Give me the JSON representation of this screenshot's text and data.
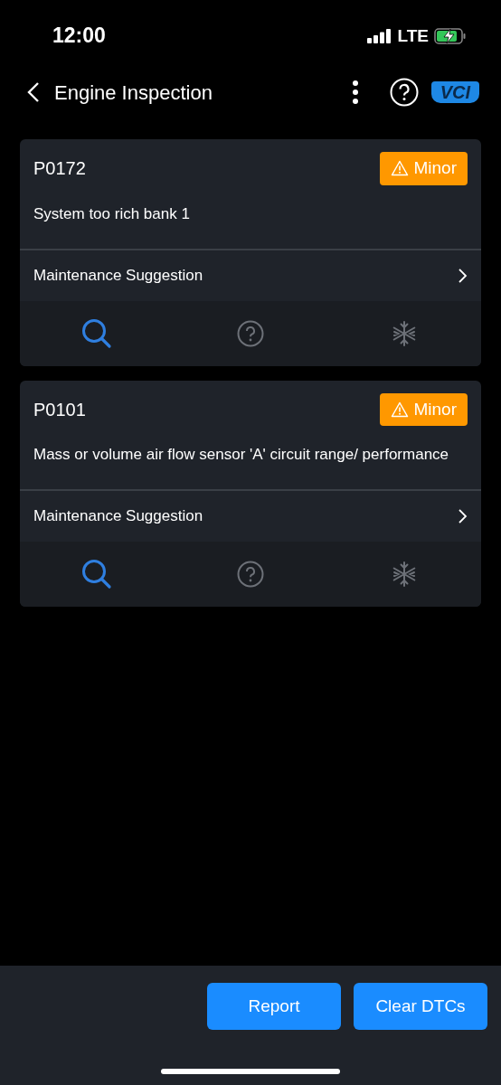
{
  "status_bar": {
    "time": "12:00",
    "network": "LTE"
  },
  "header": {
    "title": "Engine Inspection",
    "vci_label": "VCI"
  },
  "codes": [
    {
      "code": "P0172",
      "severity": "Minor",
      "description": "System too rich bank 1",
      "suggestion": "Maintenance Suggestion"
    },
    {
      "code": "P0101",
      "severity": "Minor",
      "description": "Mass or volume air flow sensor 'A' circuit range/ performance",
      "suggestion": "Maintenance Suggestion"
    }
  ],
  "buttons": [
    "Report",
    "Clear DTCs"
  ]
}
